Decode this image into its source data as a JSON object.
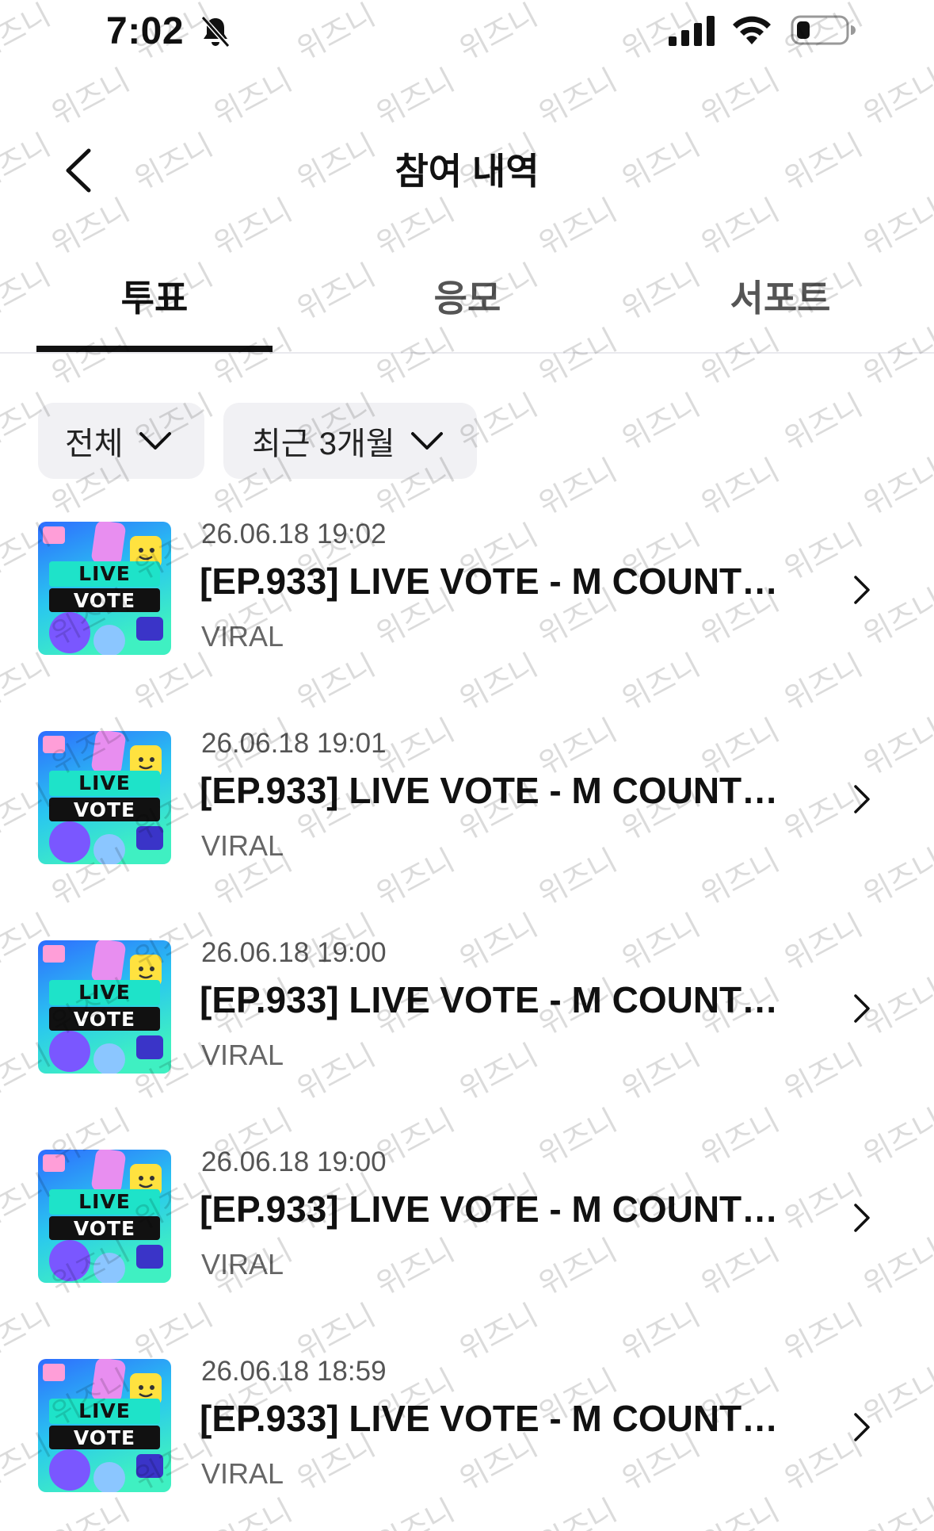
{
  "status_bar": {
    "time": "7:02",
    "icons": [
      "bell-slash-icon",
      "signal-icon",
      "wifi-icon",
      "battery-icon"
    ]
  },
  "header": {
    "title": "참여 내역",
    "back_icon": "chevron-left-icon"
  },
  "tabs": [
    {
      "label": "투표",
      "active": true
    },
    {
      "label": "응모",
      "active": false
    },
    {
      "label": "서포트",
      "active": false
    }
  ],
  "filters": {
    "category": "전체",
    "period": "최근 3개월"
  },
  "items": [
    {
      "date": "26.06.18 19:02",
      "title": "[EP.933] LIVE VOTE - M COUNTDOWN",
      "sub": "VIRAL",
      "thumb_text": [
        "LIVE",
        "VOTE"
      ]
    },
    {
      "date": "26.06.18 19:01",
      "title": "[EP.933] LIVE VOTE - M COUNTDOWN",
      "sub": "VIRAL",
      "thumb_text": [
        "LIVE",
        "VOTE"
      ]
    },
    {
      "date": "26.06.18 19:00",
      "title": "[EP.933] LIVE VOTE - M COUNTDOWN",
      "sub": "VIRAL",
      "thumb_text": [
        "LIVE",
        "VOTE"
      ]
    },
    {
      "date": "26.06.18 19:00",
      "title": "[EP.933] LIVE VOTE - M COUNTDOWN",
      "sub": "VIRAL",
      "thumb_text": [
        "LIVE",
        "VOTE"
      ]
    },
    {
      "date": "26.06.18 18:59",
      "title": "[EP.933] LIVE VOTE - M COUNTDOWN",
      "sub": "VIRAL",
      "thumb_text": [
        "LIVE",
        "VOTE"
      ]
    }
  ],
  "watermark_text": "위즈니",
  "colors": {
    "text_primary": "#111111",
    "text_secondary": "#666666",
    "filter_bg": "#f1f1f4",
    "thumb_bg_top": "#2f8cff",
    "thumb_bg_bottom": "#33e0c8",
    "thumb_banner": "#1ee3c9"
  }
}
